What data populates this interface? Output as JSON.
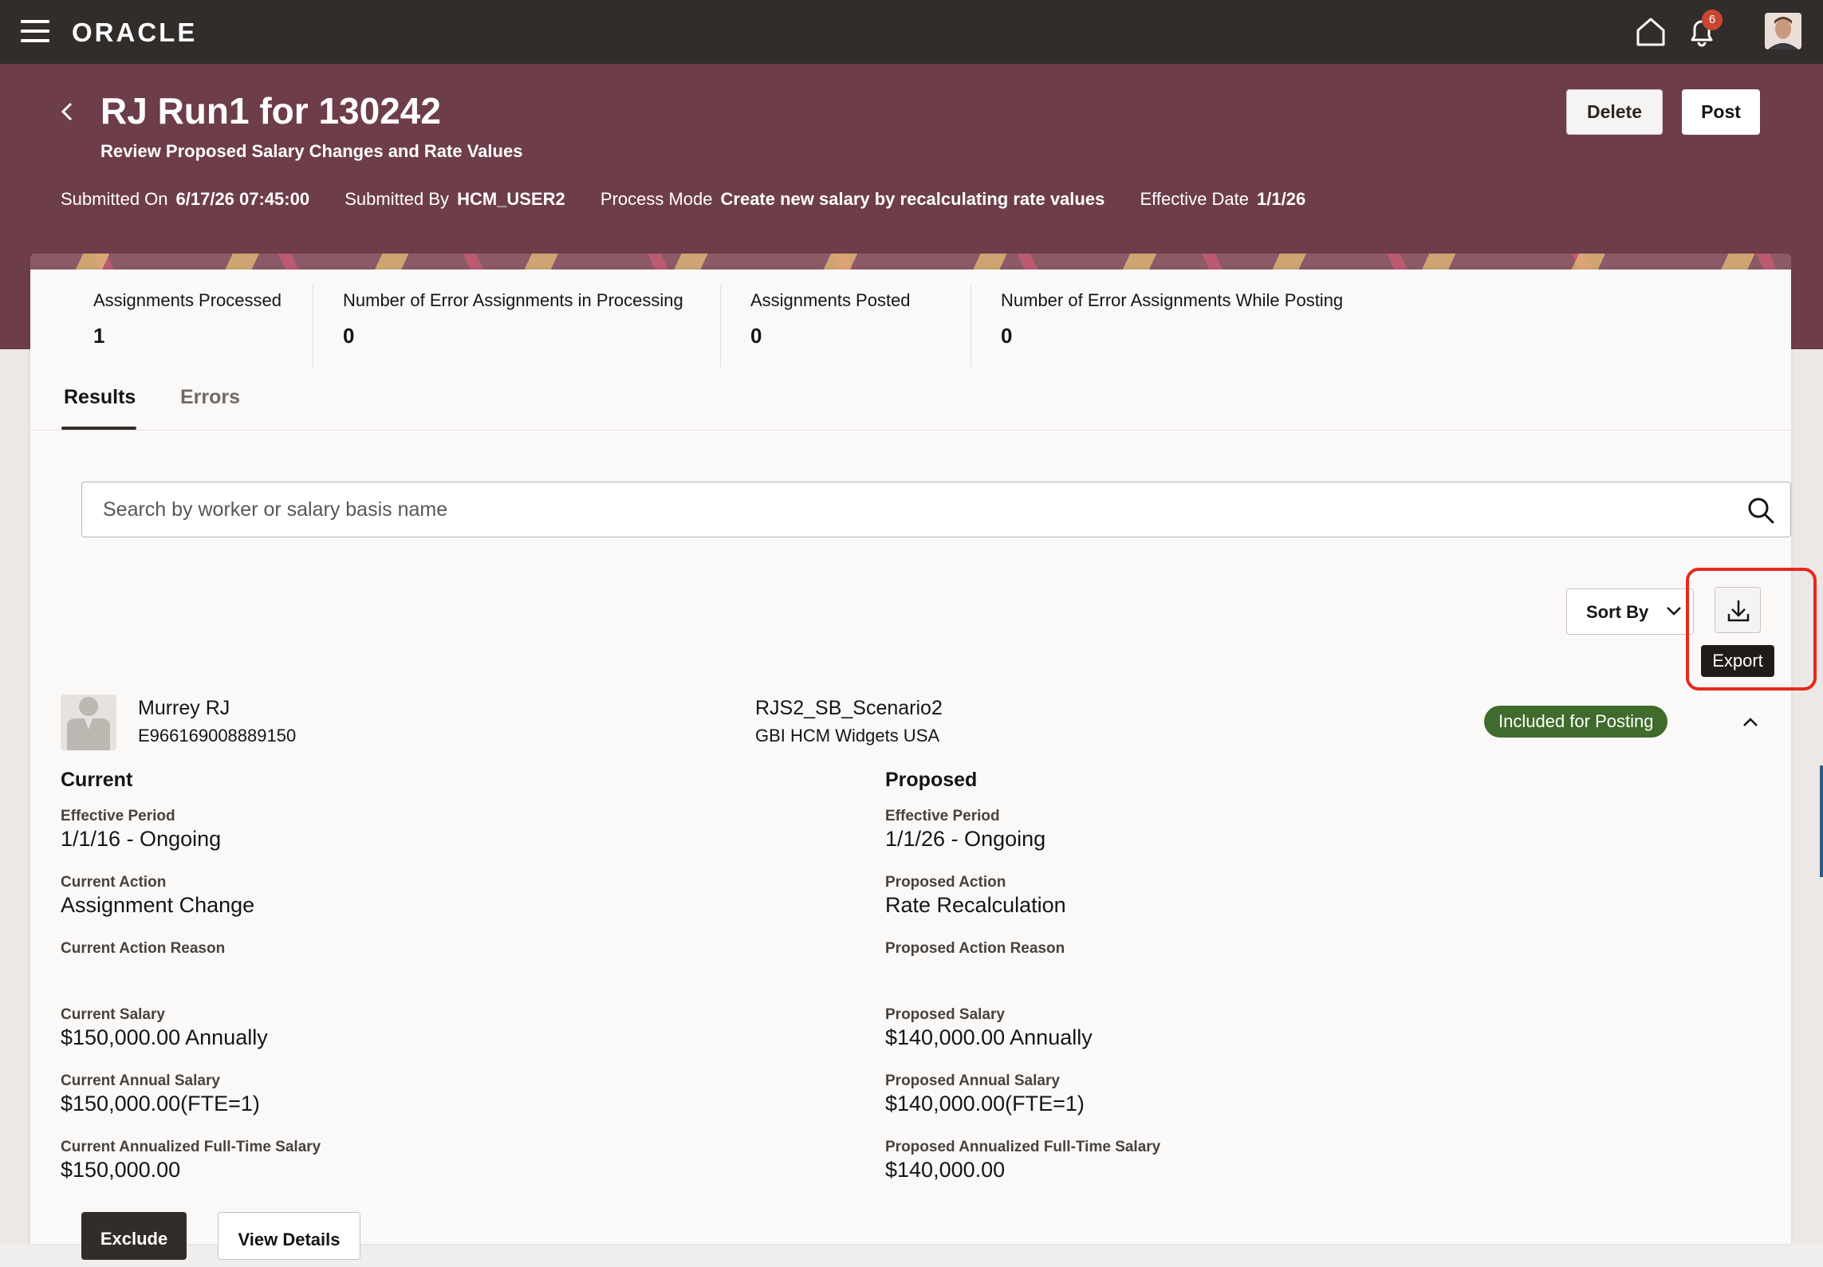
{
  "topbar": {
    "logo": "ORACLE",
    "notification_count": "6"
  },
  "header": {
    "title": "RJ Run1 for 130242",
    "subtitle": "Review Proposed Salary Changes and Rate Values",
    "delete_label": "Delete",
    "post_label": "Post",
    "meta": [
      {
        "label": "Submitted On",
        "value": "6/17/26 07:45:00"
      },
      {
        "label": "Submitted By",
        "value": "HCM_USER2"
      },
      {
        "label": "Process Mode",
        "value": "Create new salary by recalculating rate values"
      },
      {
        "label": "Effective Date",
        "value": "1/1/26"
      }
    ]
  },
  "stats": [
    {
      "label": "Assignments Processed",
      "value": "1"
    },
    {
      "label": "Number of Error Assignments in Processing",
      "value": "0"
    },
    {
      "label": "Assignments Posted",
      "value": "0"
    },
    {
      "label": "Number of Error Assignments While Posting",
      "value": "0"
    }
  ],
  "tabs": [
    {
      "label": "Results",
      "active": true
    },
    {
      "label": "Errors",
      "active": false
    }
  ],
  "search": {
    "placeholder": "Search by worker or salary basis name"
  },
  "toolbar": {
    "sort_label": "Sort By",
    "export_tooltip": "Export"
  },
  "worker": {
    "name": "Murrey RJ",
    "id": "E966169008889150",
    "salary_basis": "RJS2_SB_Scenario2",
    "org": "GBI HCM Widgets USA",
    "status": "Included for Posting"
  },
  "current": {
    "heading": "Current",
    "fields": [
      {
        "label": "Effective Period",
        "value": "1/1/16 - Ongoing"
      },
      {
        "label": "Current Action",
        "value": "Assignment Change"
      },
      {
        "label": "Current Action Reason",
        "value": ""
      },
      {
        "label": "Current Salary",
        "value": "$150,000.00 Annually"
      },
      {
        "label": "Current Annual Salary",
        "value": "$150,000.00(FTE=1)"
      },
      {
        "label": "Current Annualized Full-Time Salary",
        "value": "$150,000.00"
      }
    ]
  },
  "proposed": {
    "heading": "Proposed",
    "fields": [
      {
        "label": "Effective Period",
        "value": "1/1/26 - Ongoing"
      },
      {
        "label": "Proposed Action",
        "value": "Rate Recalculation"
      },
      {
        "label": "Proposed Action Reason",
        "value": ""
      },
      {
        "label": "Proposed Salary",
        "value": "$140,000.00 Annually"
      },
      {
        "label": "Proposed Annual Salary",
        "value": "$140,000.00(FTE=1)"
      },
      {
        "label": "Proposed Annualized Full-Time Salary",
        "value": "$140,000.00"
      }
    ]
  },
  "actions": {
    "exclude_label": "Exclude",
    "view_details_label": "View Details"
  },
  "colors": {
    "header_bg": "#6e3d4a",
    "topbar_bg": "#312d2a",
    "badge_green": "#3f6b2c",
    "highlight_red": "#e8281d"
  }
}
